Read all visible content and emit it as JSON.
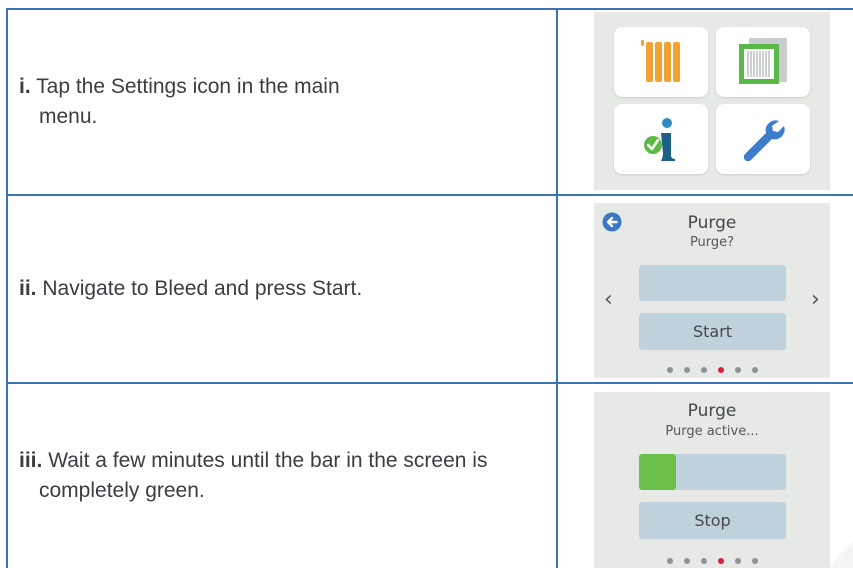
{
  "steps": [
    {
      "num": "i.",
      "line1": "Tap the Settings icon in the main",
      "line2": "menu."
    },
    {
      "num": "ii.",
      "line1": "Navigate to Bleed and press Start.",
      "line2": ""
    },
    {
      "num": "iii.",
      "line1": "Wait a few minutes until the bar in the screen is",
      "line2": "completely green."
    }
  ],
  "menu_screen": {
    "tiles": [
      "radiator-icon",
      "filter-icon",
      "info-icon",
      "wrench-icon"
    ]
  },
  "purge_screen": {
    "title": "Purge",
    "subtitle": "Purge?",
    "button": "Start",
    "page_count": 6,
    "active_page": 4
  },
  "active_screen": {
    "title": "Purge",
    "subtitle": "Purge active...",
    "button": "Stop",
    "progress": 0.25,
    "page_count": 6,
    "active_page": 4
  },
  "colors": {
    "table_border": "#3b73b9",
    "progress_green": "#6cc04a",
    "active_dot": "#d6203e"
  }
}
